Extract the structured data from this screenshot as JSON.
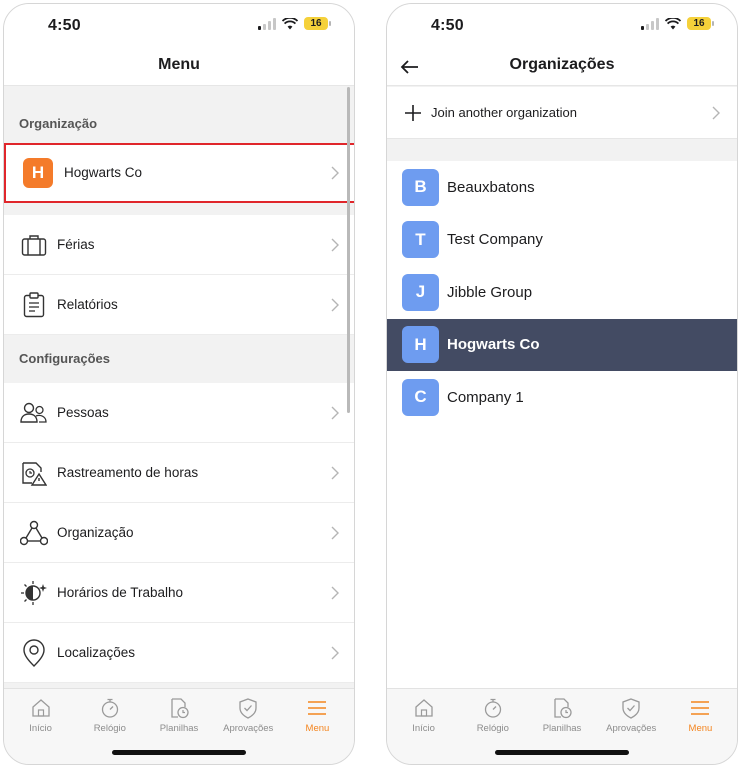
{
  "colors": {
    "accent": "#f4851f",
    "org_avatar_orange": "#f47b2a",
    "org_avatar_blue": "#6e9cf0",
    "selected_row": "#434b63",
    "highlight_border": "#e0262b",
    "battery": "#f5d13a"
  },
  "status_bar": {
    "time": "4:50",
    "battery": "16"
  },
  "left_screen": {
    "title": "Menu",
    "section_organization": "Organização",
    "current_org": {
      "initial": "H",
      "name": "Hogwarts Co"
    },
    "items_top": [
      {
        "label": "Férias",
        "icon": "suitcase-icon"
      },
      {
        "label": "Relatórios",
        "icon": "clipboard-icon"
      }
    ],
    "section_settings": "Configurações",
    "items_settings": [
      {
        "label": "Pessoas",
        "icon": "people-icon"
      },
      {
        "label": "Rastreamento de horas",
        "icon": "time-tracking-icon"
      },
      {
        "label": "Organização",
        "icon": "organization-icon"
      },
      {
        "label": "Horários de Trabalho",
        "icon": "work-schedule-icon"
      },
      {
        "label": "Localizações",
        "icon": "location-pin-icon"
      }
    ]
  },
  "right_screen": {
    "title": "Organizações",
    "join_label": "Join another organization",
    "organizations": [
      {
        "initial": "B",
        "name": "Beauxbatons",
        "selected": false
      },
      {
        "initial": "T",
        "name": "Test Company",
        "selected": false
      },
      {
        "initial": "J",
        "name": "Jibble Group",
        "selected": false
      },
      {
        "initial": "H",
        "name": "Hogwarts Co",
        "selected": true
      },
      {
        "initial": "C",
        "name": "Company 1",
        "selected": false
      }
    ]
  },
  "tab_bar": {
    "tabs": [
      {
        "label": "Início",
        "icon": "home-icon",
        "active": false
      },
      {
        "label": "Relógio",
        "icon": "stopwatch-icon",
        "active": false
      },
      {
        "label": "Planilhas",
        "icon": "timesheet-icon",
        "active": false
      },
      {
        "label": "Aprovações",
        "icon": "shield-check-icon",
        "active": false
      },
      {
        "label": "Menu",
        "icon": "hamburger-menu-icon",
        "active": true
      }
    ]
  }
}
